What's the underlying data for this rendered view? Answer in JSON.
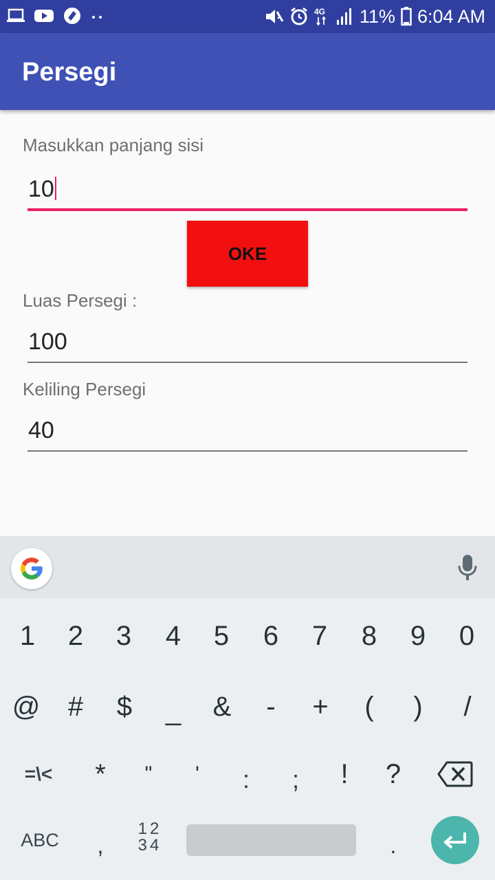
{
  "status_bar": {
    "left_icons": [
      "laptop-icon",
      "youtube-icon",
      "shazam-icon",
      "more-dots-icon"
    ],
    "network": "4G",
    "battery": "11%",
    "time": "6:04 AM"
  },
  "app_bar": {
    "title": "Persegi"
  },
  "form": {
    "side_label": "Masukkan panjang sisi",
    "side_value": "10",
    "oke_label": "OKE",
    "area_label": "Luas Persegi :",
    "area_value": "100",
    "perimeter_label": "Keliling Persegi",
    "perimeter_value": "40"
  },
  "colors": {
    "status_bar": "#303f9f",
    "app_bar": "#3f51b5",
    "accent": "#e91e63",
    "button": "#f20f0f",
    "enter_key": "#4db6ac"
  },
  "keyboard": {
    "row1": [
      "1",
      "2",
      "3",
      "4",
      "5",
      "6",
      "7",
      "8",
      "9",
      "0"
    ],
    "row2": [
      "@",
      "#",
      "$",
      "_",
      "&",
      "-",
      "+",
      "(",
      ")",
      "/"
    ],
    "row3": [
      "=\\<",
      "*",
      "\"",
      "'",
      ":",
      ";",
      "!",
      "?"
    ],
    "abc_label": "ABC",
    "comma": ",",
    "numpad_top": "12",
    "numpad_bottom": "34",
    "period": "."
  }
}
